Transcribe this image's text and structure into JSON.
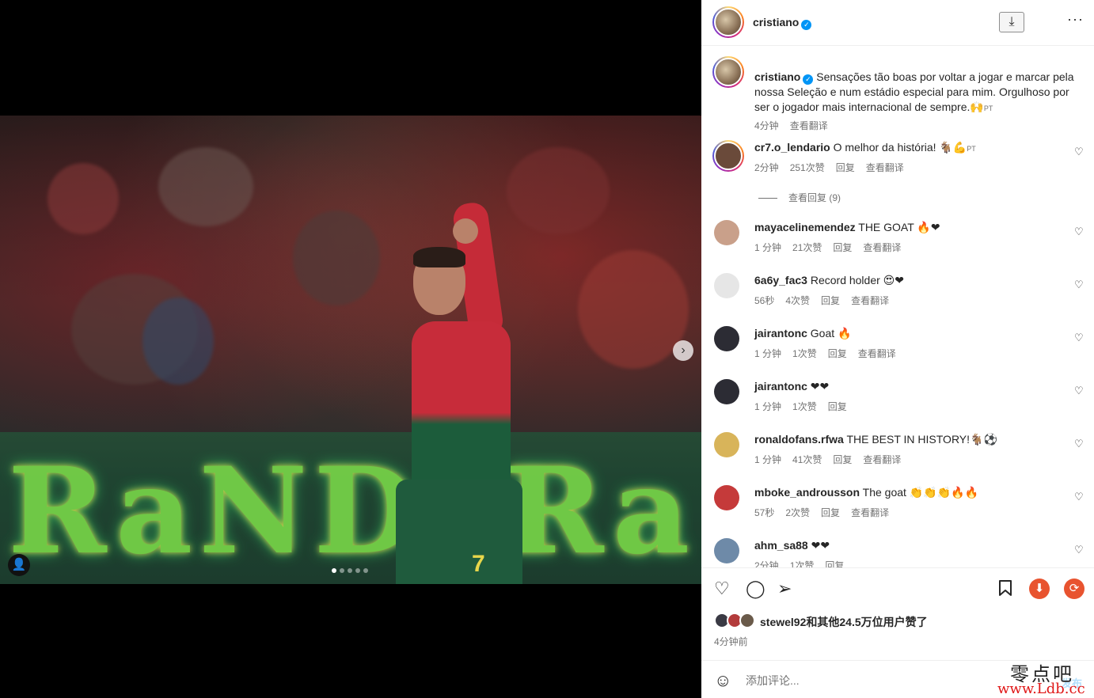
{
  "header": {
    "username": "cristiano",
    "download_icon": "download-icon",
    "more_icon": "more-options-icon",
    "more_glyph": "···",
    "download_glyph": "⤓"
  },
  "caption": {
    "username": "cristiano",
    "text": "Sensações tão boas por voltar a jogar e marcar pela nossa Seleção e num estádio especial para mim. Orgulhoso por ser o jogador mais internacional de sempre.",
    "emoji": "🙌",
    "lang": "PT",
    "time": "4分钟",
    "translate": "查看翻译"
  },
  "comments": [
    {
      "username": "cr7.o_lendario",
      "text": "O melhor da história! 🐐💪",
      "lang": "PT",
      "time": "2分钟",
      "likes": "251次赞",
      "reply": "回复",
      "translate": "查看翻译",
      "avatar_color": "#6a4a3a",
      "ring": true
    },
    {
      "username": "mayacelinemendez",
      "text": "THE GOAT 🔥❤",
      "time": "1 分钟",
      "likes": "21次赞",
      "reply": "回复",
      "translate": "查看翻译",
      "avatar_color": "#c9a08a"
    },
    {
      "username": "6a6y_fac3",
      "text": "Record holder 😍❤",
      "time": "56秒",
      "likes": "4次赞",
      "reply": "回复",
      "translate": "查看翻译",
      "avatar_color": "#e6e6e6"
    },
    {
      "username": "jairantonc",
      "text": "Goat 🔥",
      "time": "1 分钟",
      "likes": "1次赞",
      "reply": "回复",
      "translate": "查看翻译",
      "avatar_color": "#2c2c34"
    },
    {
      "username": "jairantonc",
      "text": "❤❤",
      "time": "1 分钟",
      "likes": "1次赞",
      "reply": "回复",
      "avatar_color": "#2c2c34"
    },
    {
      "username": "ronaldofans.rfwa",
      "text": "THE BEST IN HISTORY!🐐⚽",
      "time": "1 分钟",
      "likes": "41次赞",
      "reply": "回复",
      "translate": "查看翻译",
      "avatar_color": "#d8b45a"
    },
    {
      "username": "mboke_androusson",
      "text": "The goat 👏👏👏🔥🔥",
      "time": "57秒",
      "likes": "2次赞",
      "reply": "回复",
      "translate": "查看翻译",
      "avatar_color": "#c53a3a"
    },
    {
      "username": "ahm_sa88",
      "text": "❤❤",
      "time": "2分钟",
      "likes": "1次赞",
      "reply": "回复",
      "avatar_color": "#6e8aa8"
    }
  ],
  "view_replies": "查看回复 (9)",
  "actions": {
    "like_glyph": "♡",
    "comment_glyph": "◯",
    "share_glyph": "➢",
    "save_glyph": "🔖",
    "download_glyph": "⬇",
    "refresh_glyph": "⟳",
    "download_color": "#e8532f",
    "refresh_color": "#e8532f"
  },
  "likes": {
    "text": "stewel92和其他24.5万位用户赞了",
    "time": "4分钟前"
  },
  "comment_box": {
    "placeholder": "添加评论...",
    "post_label": "发布",
    "emoji_glyph": "☺"
  },
  "media": {
    "next_glyph": "›",
    "tag_glyph": "👤",
    "board_text": "RaNDeRa",
    "shirt_number": "7",
    "slide_count": 5,
    "active_slide": 1
  },
  "watermark": {
    "line1": "零点吧",
    "line2": "www.Ldb.cc"
  },
  "colors": {
    "accent": "#0095f6",
    "text": "#262626",
    "muted": "#737373"
  }
}
